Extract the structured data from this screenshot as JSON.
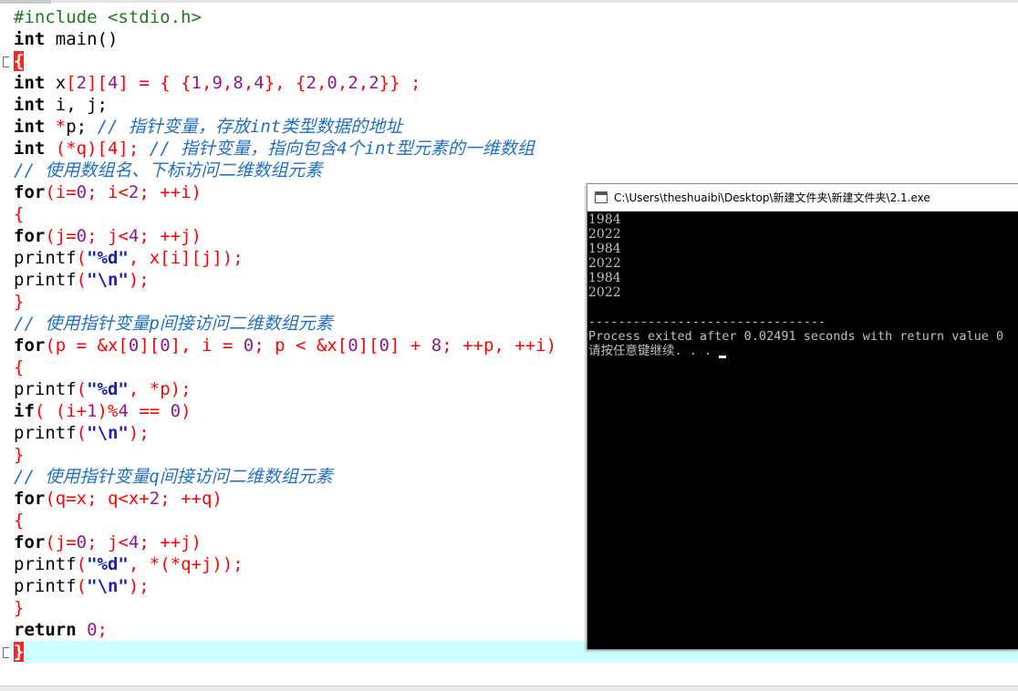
{
  "editor": {
    "lines": [
      [
        "#include",
        " <stdio.h>"
      ],
      [
        "int",
        " main()"
      ],
      [
        "{"
      ],
      [
        "int",
        " x",
        "[",
        "2",
        "][",
        "4",
        "] = { {",
        "1",
        ",",
        "9",
        ",",
        "8",
        ",",
        "4",
        "}, {",
        "2",
        ",",
        "0",
        ",",
        "2",
        ",",
        "2",
        "}} ;"
      ],
      [
        "int",
        " i, j;"
      ],
      [
        "int",
        " ",
        "*",
        "p; ",
        "// 指针变量，存放int类型数据的地址"
      ],
      [
        "int",
        " (",
        "*",
        "q)[4]; ",
        "// 指针变量，指向包含4个int型元素的一维数组"
      ],
      [
        "// 使用数组名、下标访问二维数组元素"
      ],
      [
        "for",
        "(i=",
        "0",
        "; i",
        "<",
        "2",
        "; ++i)"
      ],
      [
        "{"
      ],
      [
        "for",
        "(j=",
        "0",
        "; j",
        "<",
        "4",
        "; ++j)"
      ],
      [
        "printf",
        "(",
        "\"%d\"",
        ", x[i][j]);"
      ],
      [
        "printf",
        "(",
        "\"\\n\"",
        ");"
      ],
      [
        "}"
      ],
      [
        "// 使用指针变量p间接访问二维数组元素"
      ],
      [
        "for",
        "(p = ",
        "&",
        "x[",
        "0",
        "][",
        "0",
        "], i = ",
        "0",
        "; p < ",
        "&",
        "x[",
        "0",
        "][",
        "0",
        "] + ",
        "8",
        "; ++p, ++i)"
      ],
      [
        "{"
      ],
      [
        "printf",
        "(",
        "\"%d\"",
        ", ",
        "*",
        "p);"
      ],
      [
        "if",
        "( (i+",
        "1",
        ")%",
        "4",
        " == ",
        "0",
        ")"
      ],
      [
        "printf",
        "(",
        "\"\\n\"",
        ");"
      ],
      [
        "}"
      ],
      [
        "// 使用指针变量q间接访问二维数组元素"
      ],
      [
        "for",
        "(q=x; q",
        "<",
        "x+",
        "2",
        "; ++q)"
      ],
      [
        "{"
      ],
      [
        "for",
        "(j=",
        "0",
        "; j",
        "<",
        "4",
        "; ++j)"
      ],
      [
        "printf",
        "(",
        "\"%d\"",
        ", ",
        "*",
        "(",
        "*",
        "q+j));"
      ],
      [
        "printf",
        "(",
        "\"\\n\"",
        ");"
      ],
      [
        "}"
      ],
      [
        "return",
        " ",
        "0",
        ";"
      ],
      [
        "}"
      ]
    ]
  },
  "console": {
    "title": "C:\\Users\\theshuaibi\\Desktop\\新建文件夹\\新建文件夹\\2.1.exe",
    "output": [
      "1984",
      "2022",
      "1984",
      "2022",
      "1984",
      "2022"
    ],
    "separator": "--------------------------------",
    "exit_message": "Process exited after 0.02491 seconds with return value 0",
    "prompt": "请按任意键继续. . . "
  },
  "colors": {
    "keyword": "#000000",
    "preprocessor": "#1d7a1d",
    "number": "#8b1a8b",
    "string": "#1c1cb5",
    "operator": "#ff0000",
    "comment": "#1f6fc5",
    "current_line": "#ccffff",
    "console_bg": "#000000",
    "console_text": "#c0c0c0"
  }
}
